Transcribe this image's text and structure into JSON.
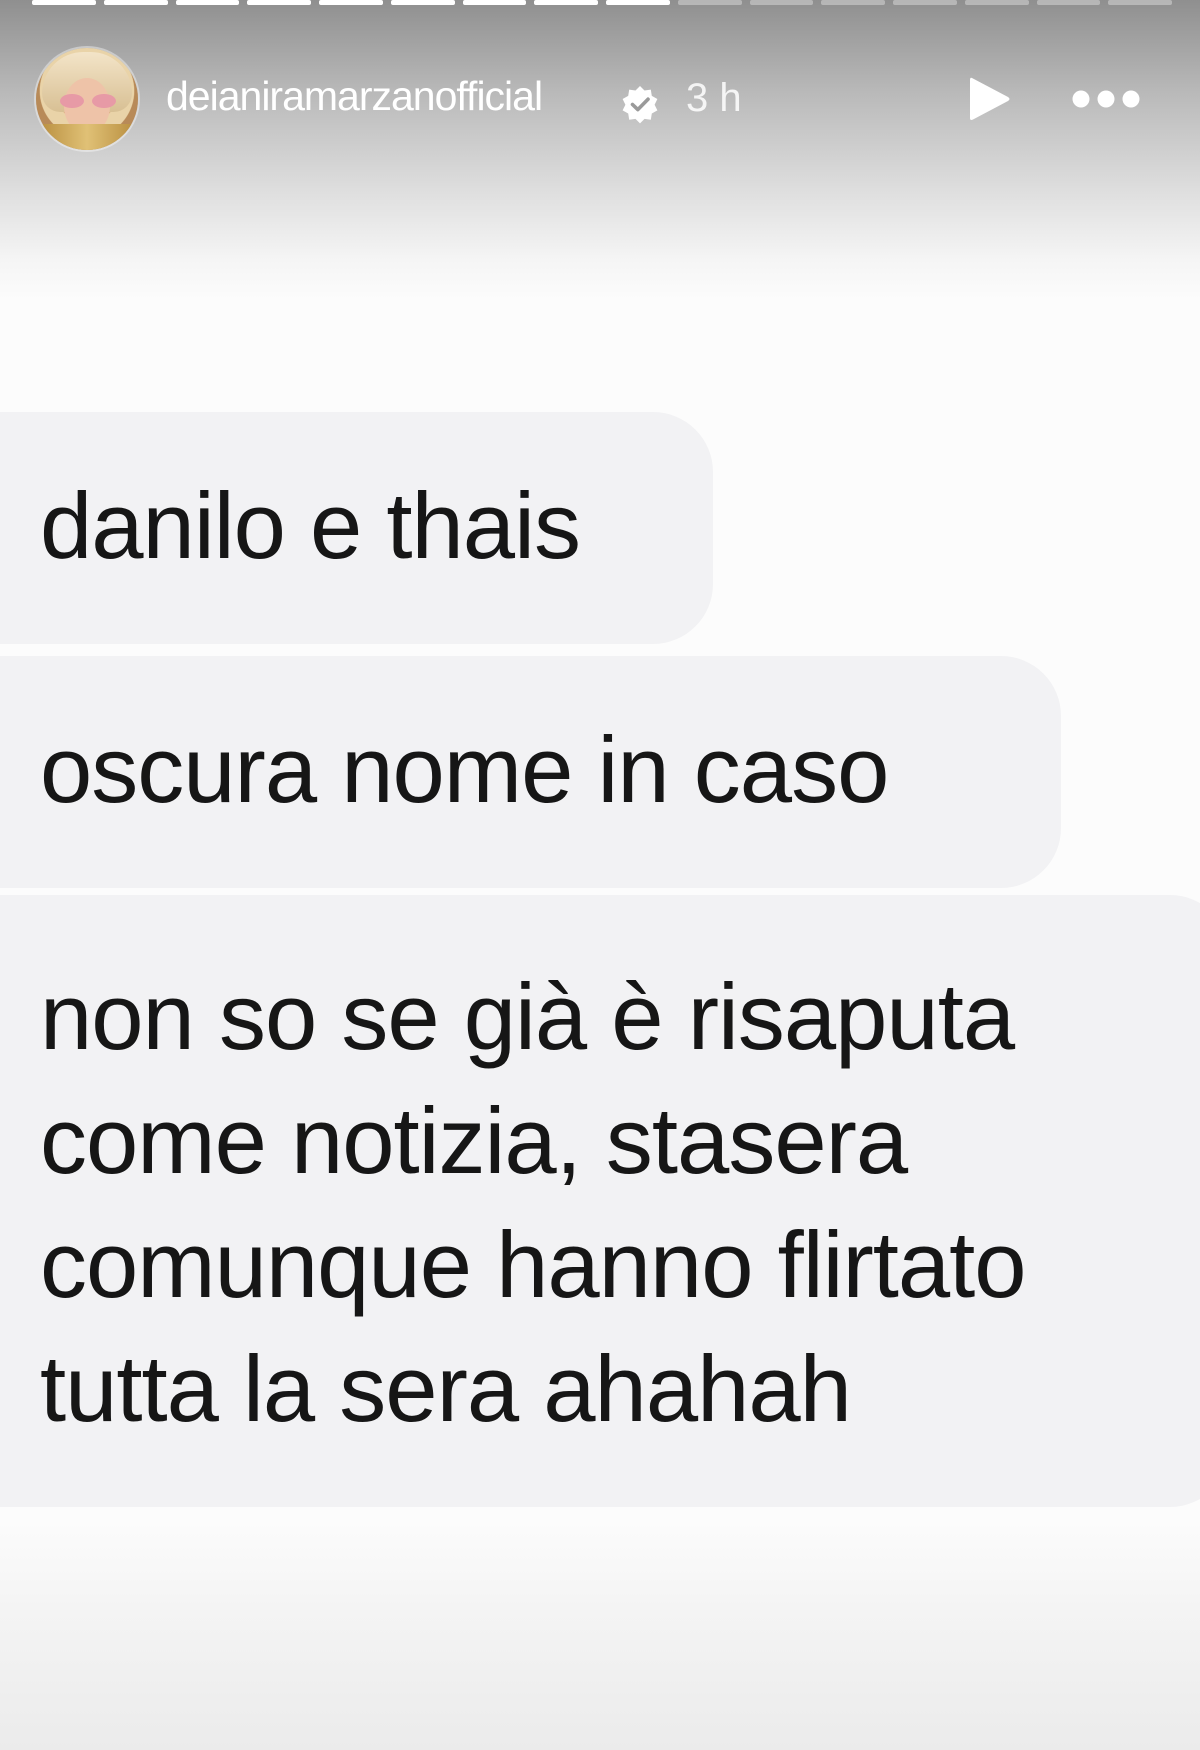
{
  "story": {
    "progress": {
      "segments_total": 16,
      "segments_done": 9
    },
    "header": {
      "username": "deianiramarzanofficial",
      "verified_icon": "verified-badge-icon",
      "time_ago": "3 h",
      "play_icon": "play-icon",
      "more_icon": "more-dots-icon"
    },
    "messages": [
      {
        "text": "danilo e thais"
      },
      {
        "text": "oscura nome in caso"
      },
      {
        "text": "non so se già è risaputa\ncome notizia, stasera\ncomunque hanno flirtato\ntutta la sera ahahah"
      }
    ]
  },
  "colors": {
    "bubble": "#f2f2f4",
    "text": "#161616",
    "header_text": "#ffffff"
  }
}
